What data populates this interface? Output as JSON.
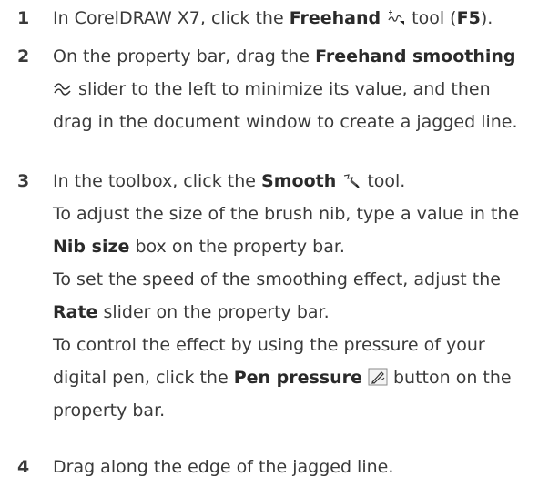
{
  "steps": [
    {
      "number": "1",
      "t1": "In CorelDRAW X7, click the ",
      "b1": "Freehand",
      "t2": " tool (",
      "b2": "F5",
      "t3": ")."
    },
    {
      "number": "2",
      "t1": "On the property bar, drag the ",
      "b1": "Freehand smoothing",
      "t2": " slider to the left to minimize its value, and then",
      "t3": "drag in the document window to create a jagged line."
    },
    {
      "number": "3",
      "t1": "In the toolbox, click the ",
      "b1": "Smooth",
      "t2": " tool.",
      "sub1_t1": "To adjust the size of the brush nib, type a value in the",
      "sub1_b1": "Nib size",
      "sub1_t2": " box on the property bar.",
      "sub2_t1": "To set the speed of the smoothing effect, adjust the",
      "sub2_b1": "Rate",
      "sub2_t2": " slider on the property bar.",
      "sub3_t1": "To control the effect by using the pressure of your",
      "sub3_t2": "digital pen, click the ",
      "sub3_b1": "Pen pressure",
      "sub3_t3": " button on the",
      "sub3_t4": "property bar."
    },
    {
      "number": "4",
      "t1": "Drag along the edge of the jagged line."
    }
  ],
  "icons": {
    "freehand": "freehand-tool-icon",
    "smoothing": "freehand-smoothing-icon",
    "smooth": "smooth-tool-icon",
    "pen_pressure": "pen-pressure-icon"
  }
}
